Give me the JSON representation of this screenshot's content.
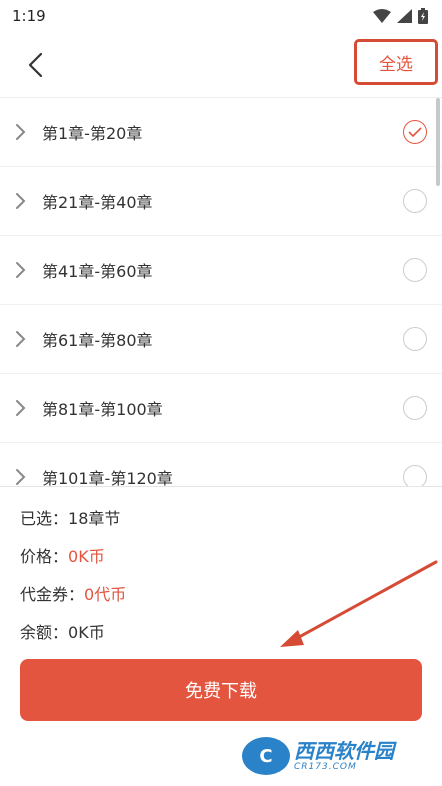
{
  "status_bar": {
    "time": "1:19"
  },
  "header": {
    "select_all_label": "全选"
  },
  "chapters": [
    {
      "label": "第1章-第20章",
      "selected": true
    },
    {
      "label": "第21章-第40章",
      "selected": false
    },
    {
      "label": "第41章-第60章",
      "selected": false
    },
    {
      "label": "第61章-第80章",
      "selected": false
    },
    {
      "label": "第81章-第100章",
      "selected": false
    },
    {
      "label": "第101章-第120章",
      "selected": false
    }
  ],
  "summary": {
    "selected_label": "已选：",
    "selected_value": "18章节",
    "price_label": "价格：",
    "price_value": "0K币",
    "voucher_label": "代金券：",
    "voucher_value": "0代币",
    "balance_label": "余额：",
    "balance_value": "0K币"
  },
  "download_button": {
    "label": "免费下载"
  },
  "watermark": {
    "name": "西西软件园",
    "domain": "CR173.COM"
  },
  "colors": {
    "accent": "#e3553f",
    "highlight_box": "#d64b35",
    "watermark": "#2a82c9"
  }
}
